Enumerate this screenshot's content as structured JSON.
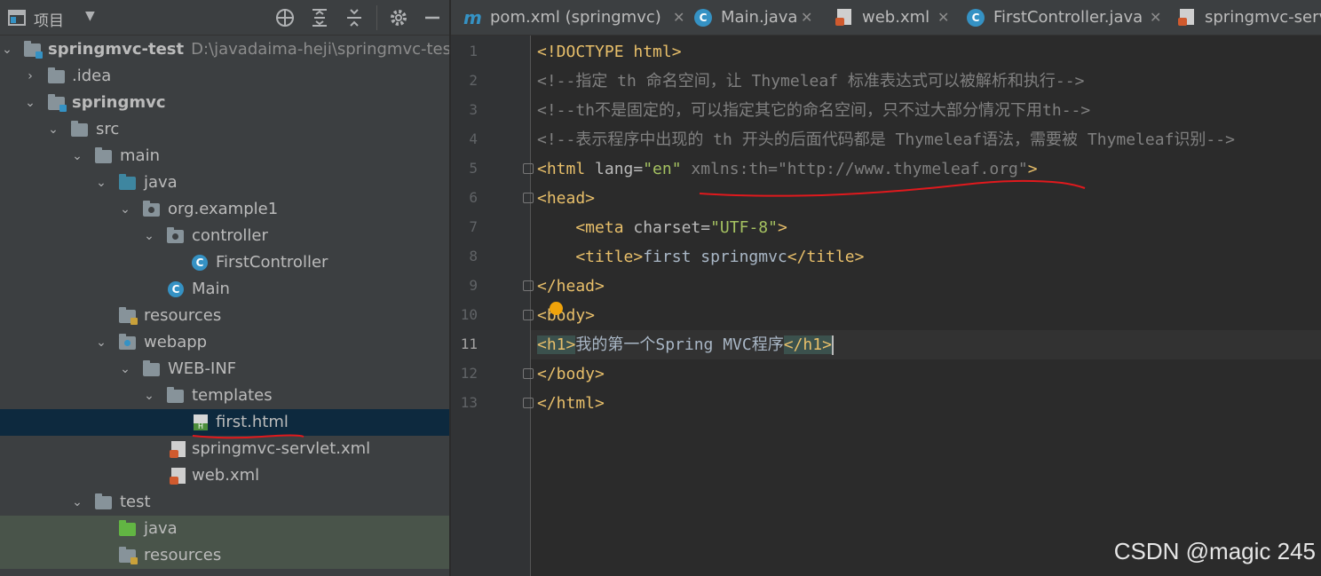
{
  "project_panel": {
    "title": "项目",
    "toolbar_icons": [
      "target-icon",
      "expand-all-icon",
      "collapse-all-icon",
      "gear-icon",
      "minimize-icon"
    ],
    "tree": [
      {
        "label": "springmvc-test",
        "path": "D:\\javadaima-heji\\springmvc-test",
        "icon": "module-folder",
        "expanded": true,
        "bold": true
      },
      {
        "label": ".idea",
        "icon": "folder",
        "expanded": false
      },
      {
        "label": "springmvc",
        "icon": "module-folder",
        "expanded": true,
        "bold": true
      },
      {
        "label": "src",
        "icon": "folder",
        "expanded": true
      },
      {
        "label": "main",
        "icon": "folder",
        "expanded": true
      },
      {
        "label": "java",
        "icon": "source-folder",
        "expanded": true
      },
      {
        "label": "org.example1",
        "icon": "package",
        "expanded": true
      },
      {
        "label": "controller",
        "icon": "package",
        "expanded": true
      },
      {
        "label": "FirstController",
        "icon": "class"
      },
      {
        "label": "Main",
        "icon": "class"
      },
      {
        "label": "resources",
        "icon": "resources-folder"
      },
      {
        "label": "webapp",
        "icon": "web-folder",
        "expanded": true
      },
      {
        "label": "WEB-INF",
        "icon": "folder",
        "expanded": true
      },
      {
        "label": "templates",
        "icon": "folder",
        "expanded": true
      },
      {
        "label": "first.html",
        "icon": "html-file",
        "selected": true
      },
      {
        "label": "springmvc-servlet.xml",
        "icon": "xml-file"
      },
      {
        "label": "web.xml",
        "icon": "xml-file"
      },
      {
        "label": "test",
        "icon": "folder",
        "expanded": true
      },
      {
        "label": "java",
        "icon": "test-source-folder"
      },
      {
        "label": "resources",
        "icon": "test-resources-folder"
      }
    ]
  },
  "tabs": [
    {
      "label": "pom.xml (springmvc)",
      "icon": "maven-icon"
    },
    {
      "label": "Main.java",
      "icon": "class-icon"
    },
    {
      "label": "web.xml",
      "icon": "xml-icon"
    },
    {
      "label": "FirstController.java",
      "icon": "class-icon"
    },
    {
      "label": "springmvc-servl",
      "icon": "xml-icon"
    }
  ],
  "editor": {
    "current_line": 11,
    "line_numbers": [
      "1",
      "2",
      "3",
      "4",
      "5",
      "6",
      "7",
      "8",
      "9",
      "10",
      "11",
      "12",
      "13"
    ],
    "lines": [
      {
        "t1": "<!DOCTYPE html>"
      },
      {
        "t1": "<!--指定 th 命名空间，让 Thymeleaf 标准表达式可以被解析和执行-->"
      },
      {
        "t1": "<!--th不是固定的，可以指定其它的命名空间，只不过大部分情况下用th-->"
      },
      {
        "t1": "<!--表示程序中出现的 th 开头的后面代码都是 Thymeleaf语法，需要被 Thymeleaf识别-->"
      },
      {
        "t1": "<html",
        "t2": " lang=",
        "t3": "\"en\"",
        "t4": " xmlns:th=",
        "t5": "\"http://www.thymeleaf.org\"",
        "t6": ">"
      },
      {
        "t1": "<head>"
      },
      {
        "t1": "    <meta",
        "t2": " charset=",
        "t3": "\"UTF-8\"",
        "t4": ">"
      },
      {
        "t1": "    <title>",
        "t2": "first springmvc",
        "t3": "</title>"
      },
      {
        "t1": "</head>"
      },
      {
        "t1": "<body>"
      },
      {
        "t1": "<h1>",
        "t2": "我的第一个Spring MVC程序",
        "t3": "</h1>"
      },
      {
        "t1": "</body>"
      },
      {
        "t1": "</html>"
      }
    ]
  },
  "watermark": "CSDN @magic 245",
  "colors": {
    "panel_bg": "#3c3f41",
    "editor_bg": "#2b2b2b",
    "selection": "#0d293e",
    "tag": "#e8bf6a",
    "string": "#a5c261",
    "comment": "#808080",
    "annotation_red": "#e0191d"
  }
}
